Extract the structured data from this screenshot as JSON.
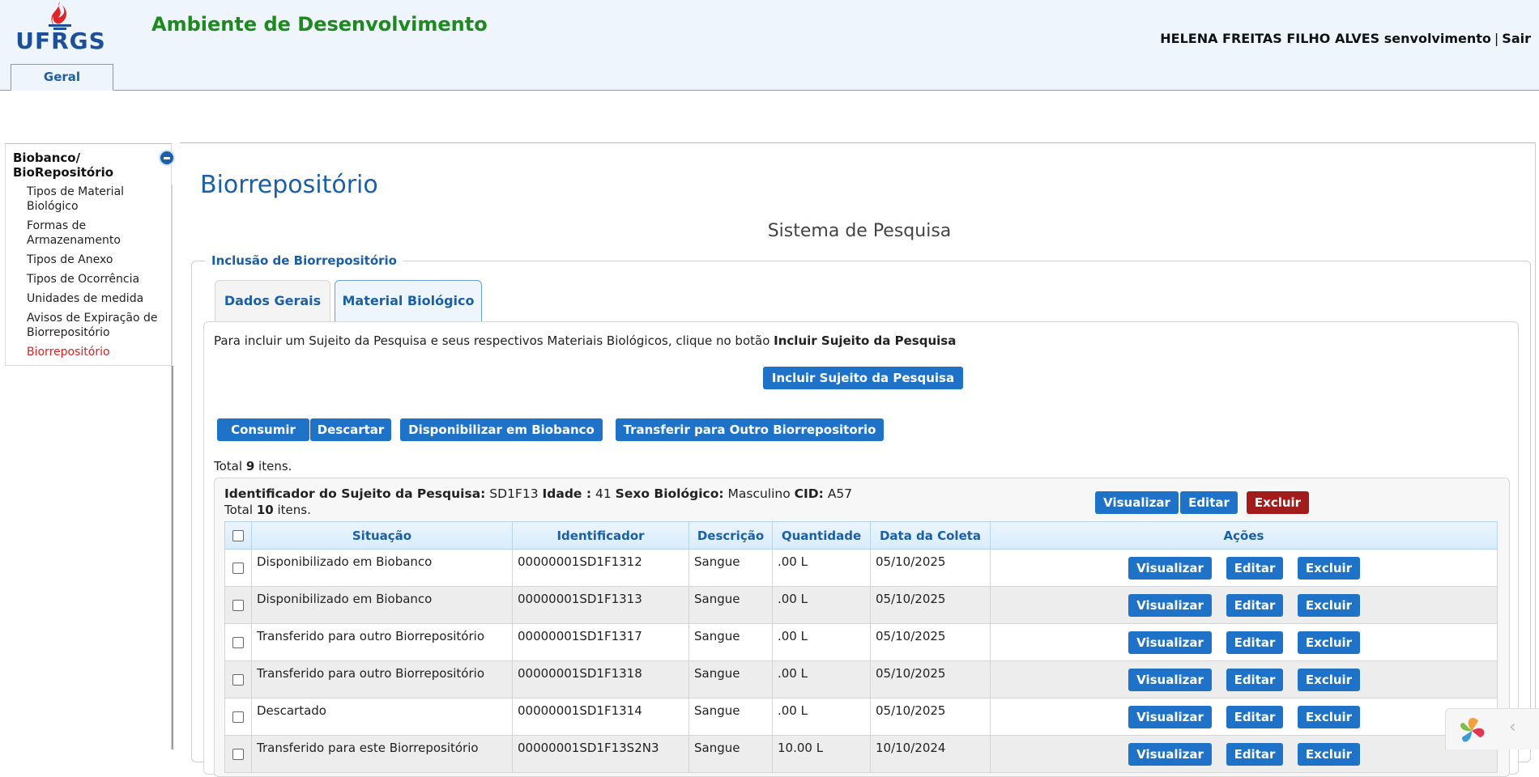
{
  "header": {
    "logo_text": "UFRGS",
    "env_title": "Ambiente de Desenvolvimento",
    "user_name": "HELENA FREITAS FILHO ALVES senvolvimento",
    "separator": "|",
    "logout": "Sair",
    "tab_label": "Geral"
  },
  "sidebar": {
    "title": "Biobanco/ BioRepositório",
    "items": [
      {
        "label": "Tipos de Material Biológico"
      },
      {
        "label": "Formas de Armazenamento"
      },
      {
        "label": "Tipos de Anexo"
      },
      {
        "label": "Tipos de Ocorrência"
      },
      {
        "label": "Unidades de medida"
      },
      {
        "label": "Avisos de Expiração de Biorrepositório"
      },
      {
        "label": "Biorrepositório"
      }
    ]
  },
  "main": {
    "page_title": "Biorrepositório",
    "system_title": "Sistema de Pesquisa",
    "fieldset_legend": "Inclusão de Biorrepositório",
    "tabs": [
      {
        "label": "Dados Gerais"
      },
      {
        "label": "Material Biológico"
      }
    ],
    "instructions_prefix": "Para incluir um Sujeito da Pesquisa e seus respectivos Materiais Biológicos, clique no botão",
    "instructions_bold": "Incluir Sujeito da Pesquisa",
    "btn_incluir": "Incluir Sujeito da Pesquisa",
    "btn_consumir": "Consumir",
    "btn_descartar": "Descartar",
    "btn_disponibilizar": "Disponibilizar em Biobanco",
    "btn_transferir": "Transferir para Outro Biorrepositorio",
    "total_prefix": "Total",
    "total_count": "9",
    "total_suffix": "itens."
  },
  "subject": {
    "id_label": "Identificador do Sujeito da Pesquisa:",
    "id_value": "SD1F13",
    "age_label": "Idade :",
    "age_value": "41",
    "sex_label": "Sexo Biológico:",
    "sex_value": "Masculino",
    "cid_label": "CID:",
    "cid_value": "A57",
    "total_prefix": "Total",
    "total_count": "10",
    "total_suffix": "itens.",
    "btn_visualizar": "Visualizar",
    "btn_editar": "Editar",
    "btn_excluir": "Excluir"
  },
  "table": {
    "columns": [
      "Situação",
      "Identificador",
      "Descrição",
      "Quantidade",
      "Data da Coleta",
      "Ações"
    ],
    "action_labels": {
      "view": "Visualizar",
      "edit": "Editar",
      "delete": "Excluir"
    },
    "rows": [
      {
        "situacao": "Disponibilizado em Biobanco",
        "identificador": "00000001SD1F1312",
        "descricao": "Sangue",
        "quantidade": ".00 L",
        "data": "05/10/2025"
      },
      {
        "situacao": "Disponibilizado em Biobanco",
        "identificador": "00000001SD1F1313",
        "descricao": "Sangue",
        "quantidade": ".00 L",
        "data": "05/10/2025"
      },
      {
        "situacao": "Transferido para outro Biorrepositório",
        "identificador": "00000001SD1F1317",
        "descricao": "Sangue",
        "quantidade": ".00 L",
        "data": "05/10/2025"
      },
      {
        "situacao": "Transferido para outro Biorrepositório",
        "identificador": "00000001SD1F1318",
        "descricao": "Sangue",
        "quantidade": ".00 L",
        "data": "05/10/2025"
      },
      {
        "situacao": "Descartado",
        "identificador": "00000001SD1F1314",
        "descricao": "Sangue",
        "quantidade": ".00 L",
        "data": "05/10/2025"
      },
      {
        "situacao": "Transferido para este Biorrepositório",
        "identificador": "00000001SD1F13S2N3",
        "descricao": "Sangue",
        "quantidade": "10.00 L",
        "data": "10/10/2024"
      }
    ]
  },
  "colors": {
    "primary_button": "#1e73c8",
    "danger_button": "#a21c1c",
    "title_blue": "#1a5fa8",
    "env_green": "#1c8a1c",
    "active_menu_red": "#e02020"
  },
  "icons": {
    "collapse": "minus-circle-icon",
    "logo_flame": "ufrgs-flame-icon",
    "widget": "pinwheel-icon",
    "widget_toggle": "chevron-left-icon"
  }
}
